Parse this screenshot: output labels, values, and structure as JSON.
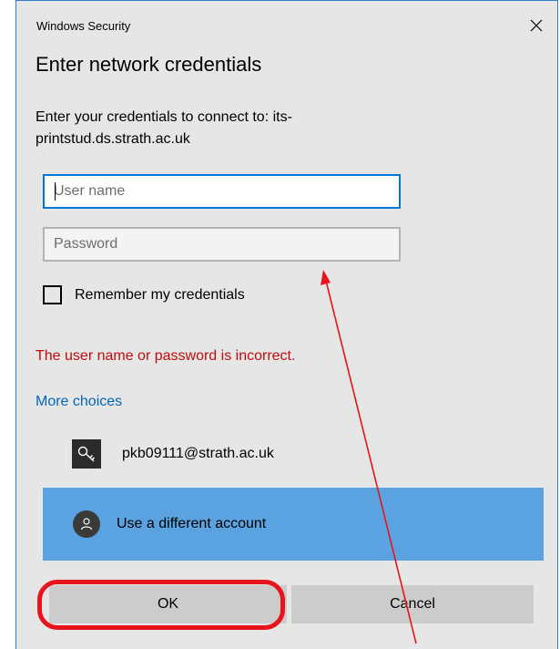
{
  "window": {
    "title": "Windows Security"
  },
  "dialog": {
    "heading": "Enter network credentials",
    "prompt": "Enter your credentials to connect to: its-printstud.ds.strath.ac.uk"
  },
  "form": {
    "username_placeholder": "User name",
    "username_value": "",
    "password_placeholder": "Password",
    "password_value": "",
    "remember_label": "Remember my credentials",
    "remember_checked": false
  },
  "error_message": "The user name or password is incorrect.",
  "more_choices": {
    "label": "More choices",
    "accounts": [
      {
        "label": "pkb09111@strath.ac.uk",
        "icon": "key-icon"
      },
      {
        "label": "Use a different account",
        "icon": "person-icon",
        "selected": true
      }
    ]
  },
  "buttons": {
    "ok": "OK",
    "cancel": "Cancel"
  },
  "colors": {
    "dialog_bg": "#e6e6e6",
    "error": "#c40b0b",
    "link": "#0067c0",
    "selected_account_bg": "#5ba3e0",
    "input_focus_border": "#0078d7",
    "annotation": "#e8141c"
  },
  "icons": {
    "close": "close-icon",
    "key": "key-icon",
    "person": "person-icon",
    "checkbox": "checkbox-icon"
  }
}
